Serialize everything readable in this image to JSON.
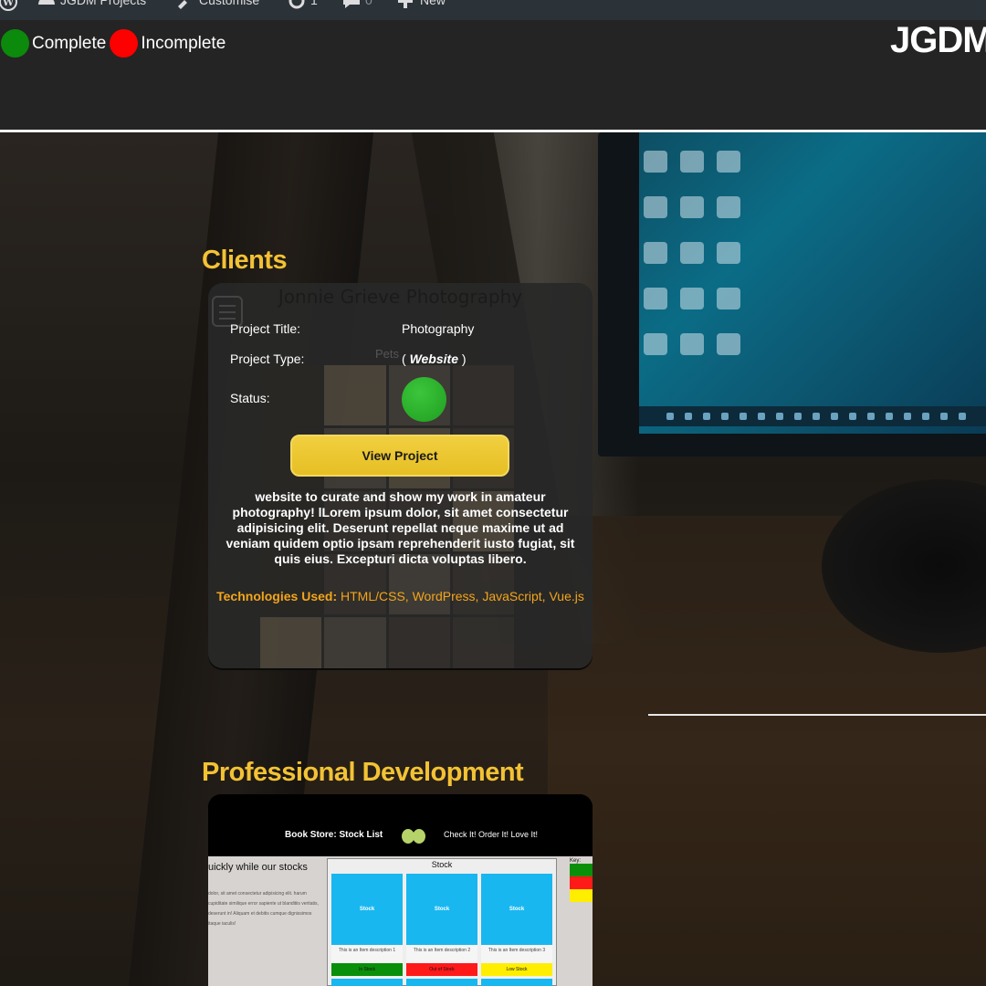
{
  "admin_bar": {
    "items": [
      {
        "icon": "wordpress-icon",
        "label": ""
      },
      {
        "icon": "dashboard-icon",
        "label": "JGDM Projects"
      },
      {
        "icon": "brush-icon",
        "label": "Customise"
      },
      {
        "icon": "updates-icon",
        "label": "1"
      },
      {
        "icon": "comment-icon",
        "label": "0"
      },
      {
        "icon": "plus-icon",
        "label": "New"
      }
    ]
  },
  "header": {
    "key_complete": "Complete",
    "key_incomplete": "Incomplete",
    "logo": "JGDM",
    "colors": {
      "complete": "#0b8a0b",
      "incomplete": "#ff0000"
    }
  },
  "clients": {
    "heading": "Clients",
    "card": {
      "screenshot_title": "Jonnie Grieve Photography",
      "screenshot_menu_label": "Pets",
      "title_label": "Project Title:",
      "title_value": "Photography",
      "type_label": "Project Type:",
      "type_open": "( ",
      "type_value": "Website",
      "type_close": " )",
      "status_label": "Status:",
      "status": "complete",
      "button_label": "View Project",
      "description": "website to curate and show my work in amateur photography! lLorem ipsum dolor, sit amet consectetur adipisicing elit. Deserunt repellat neque maxime ut ad veniam quidem optio ipsam reprehenderit iusto fugiat, sit quis eius. Excepturi dicta voluptas libero.",
      "tech_label": "Technologies Used:",
      "tech_value": "HTML/CSS, WordPress, JavaScript, Vue.js"
    }
  },
  "professional_development": {
    "heading": "Professional Development",
    "card": {
      "site_title": "Book Store: Stock List",
      "site_tagline": "Check It! Order It! Love It!",
      "lead_text": "uickly while our stocks",
      "body_text": "dolor, sit amet consectetur adipisicing elit. harum cupiditate similique error sapiente ut blanditiis veritatis, deserunt in! Aliquam et debitis cumque dignissimos itaque iaculis!",
      "stock_title": "Stock",
      "items": [
        {
          "tile": "Stock",
          "desc": "This is an Item description 1",
          "badge": "In Stock",
          "color": "#0a8f0a"
        },
        {
          "tile": "Stock",
          "desc": "This is an Item description 2",
          "badge": "Out of Stock",
          "color": "#ff1a1a"
        },
        {
          "tile": "Stock",
          "desc": "This is an Item description 3",
          "badge": "Low Stock",
          "color": "#ffee00"
        }
      ],
      "key_label": "Key:",
      "key_colors": [
        "#0a8f0a",
        "#ff1a1a",
        "#ffee00"
      ]
    }
  }
}
